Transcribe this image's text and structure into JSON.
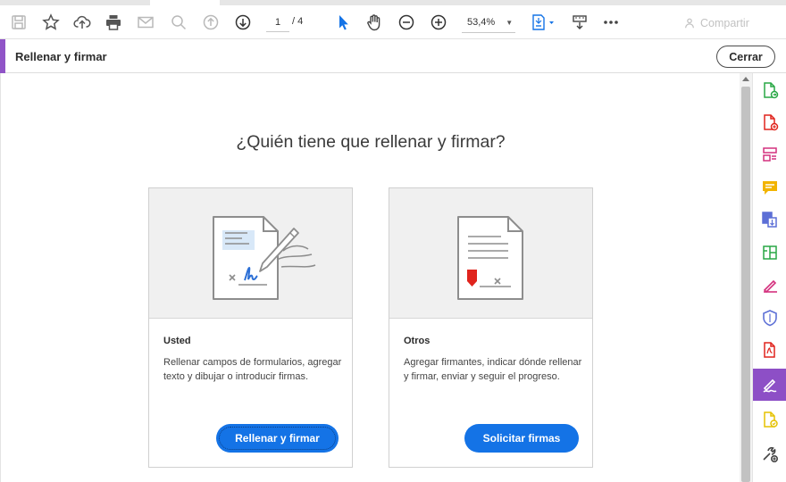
{
  "toolbar": {
    "page_current": "1",
    "page_total": "/ 4",
    "zoom_value": "53,4%",
    "share_label": "Compartir"
  },
  "tool_header": {
    "title": "Rellenar y firmar",
    "close_label": "Cerrar"
  },
  "main": {
    "question": "¿Quién tiene que rellenar y firmar?",
    "cards": [
      {
        "title": "Usted",
        "description": "Rellenar campos de formularios, agregar texto y dibujar o introducir firmas.",
        "button": "Rellenar y firmar"
      },
      {
        "title": "Otros",
        "description": "Agregar firmantes, indicar dónde rellenar y firmar, enviar y seguir el progreso.",
        "button": "Solicitar firmas"
      }
    ]
  },
  "colors": {
    "accent_purple": "#9054c7",
    "primary_blue": "#1473e6",
    "signature_blue": "#2b6fd6",
    "request_red": "#e0241d"
  },
  "right_panel_icons": [
    "export-pdf-icon",
    "create-pdf-icon",
    "organize-pages-icon",
    "comment-icon",
    "combine-files-icon",
    "edit-pdf-icon",
    "fill-sign-pen-icon",
    "protect-shield-icon",
    "acrobat-pdf-icon",
    "fill-sign-active-icon",
    "send-review-icon",
    "more-tools-icon"
  ]
}
